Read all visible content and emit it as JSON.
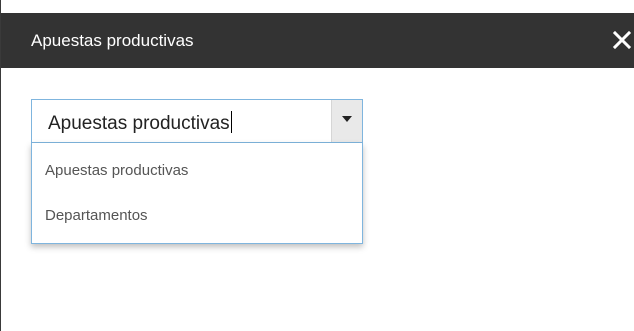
{
  "dialog": {
    "title": "Apuestas productivas",
    "close_icon": "close-icon"
  },
  "combo": {
    "value": "Apuestas productivas",
    "arrow_icon": "chevron-down-icon",
    "accent_color": "#7fb5de"
  },
  "dropdown": {
    "options": [
      {
        "label": "Apuestas productivas"
      },
      {
        "label": "Departamentos"
      }
    ]
  },
  "colors": {
    "titlebar": "#333333",
    "title_text": "#ffffff",
    "option_text": "#555555"
  }
}
